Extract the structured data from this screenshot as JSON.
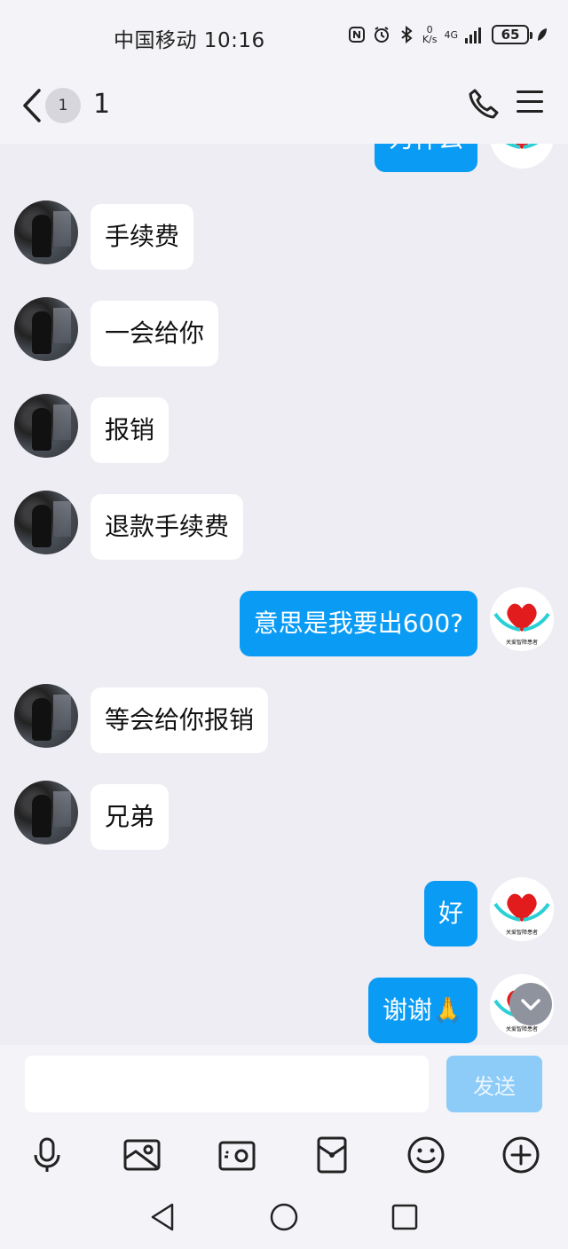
{
  "status_bar": {
    "carrier_time": "中国移动 10:16",
    "net_speed_value": "0",
    "net_speed_unit": "K/s",
    "signal_label": "4G",
    "battery": "65"
  },
  "header": {
    "unread_count": "1",
    "title": "1"
  },
  "messages": [
    {
      "side": "out",
      "text": "为什么"
    },
    {
      "side": "in",
      "text": "手续费"
    },
    {
      "side": "in",
      "text": "一会给你"
    },
    {
      "side": "in",
      "text": "报销"
    },
    {
      "side": "in",
      "text": "退款手续费"
    },
    {
      "side": "out",
      "text": "意思是我要出600?"
    },
    {
      "side": "in",
      "text": "等会给你报销"
    },
    {
      "side": "in",
      "text": "兄弟"
    },
    {
      "side": "out",
      "text": "好"
    },
    {
      "side": "out",
      "text": "谢谢🙏"
    }
  ],
  "avatar_logo_text": "关爱智障患者",
  "input": {
    "placeholder": "",
    "send_label": "发送"
  },
  "colors": {
    "outgoing_bubble": "#0a9bf5",
    "send_button": "#8dccf8",
    "background": "#eeedf3"
  },
  "icons": {
    "toolbar": [
      "microphone-icon",
      "image-icon",
      "camera-icon",
      "red-packet-icon",
      "emoji-icon",
      "plus-icon"
    ],
    "nav": [
      "back-triangle-icon",
      "home-circle-icon",
      "recent-square-icon"
    ]
  }
}
